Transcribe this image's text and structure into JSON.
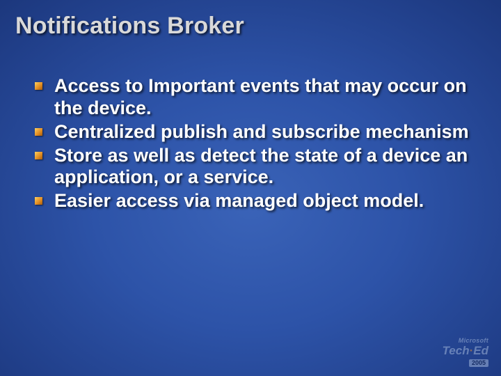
{
  "title": "Notifications Broker",
  "bullets": [
    "Access to Important events that may occur on the device.",
    "Centralized publish and subscribe mechanism",
    "Store as well as detect the state of a device an application, or a service.",
    "Easier access via managed object model."
  ],
  "branding": {
    "company": "Microsoft",
    "event": "Tech·Ed",
    "year": "2005"
  }
}
